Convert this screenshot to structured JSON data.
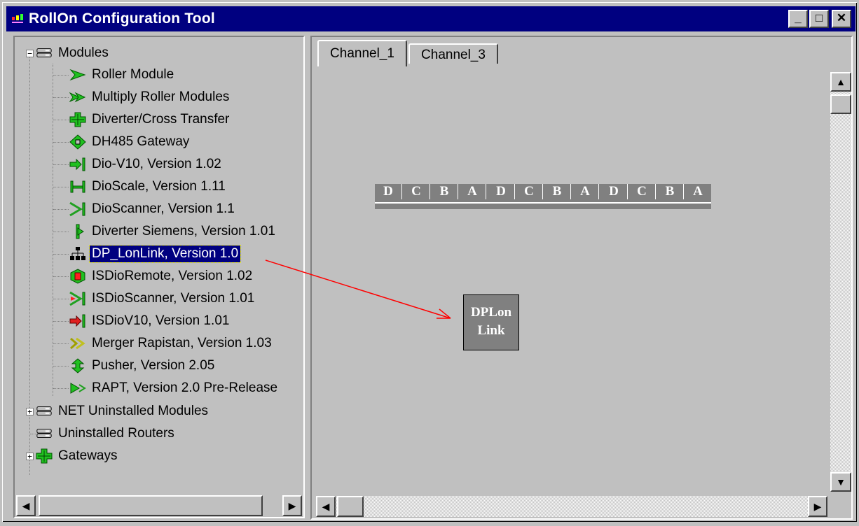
{
  "window": {
    "title": "RollOn Configuration Tool",
    "controls": [
      "_",
      "□",
      "✕"
    ]
  },
  "tree": {
    "root": "Modules",
    "children": [
      "Roller Module",
      "Multiply Roller Modules",
      "Diverter/Cross Transfer",
      "DH485 Gateway",
      "Dio-V10, Version 1.02",
      "DioScale, Version 1.11",
      "DioScanner, Version 1.1",
      "Diverter Siemens, Version 1.01",
      "DP_LonLink, Version 1.0",
      "ISDioRemote, Version 1.02",
      "ISDioScanner, Version 1.01",
      "ISDioV10, Version 1.01",
      "Merger Rapistan, Version 1.03",
      "Pusher, Version 2.05",
      "RAPT, Version 2.0 Pre-Release"
    ],
    "selected": "DP_LonLink, Version 1.0",
    "others": [
      "NET Uninstalled Modules",
      "Uninstalled Routers",
      "Gateways"
    ]
  },
  "tabs": [
    "Channel_1",
    "Channel_3"
  ],
  "active_tab": "Channel_1",
  "channel_segments": [
    "D",
    "C",
    "B",
    "A"
  ],
  "placed_module": {
    "line1": "DPLon",
    "line2": "Link"
  },
  "colors": {
    "titlebar": "#000080",
    "face": "#c0c0c0",
    "selection": "#000080",
    "arrow": "#ff0000",
    "module": "#808080"
  }
}
